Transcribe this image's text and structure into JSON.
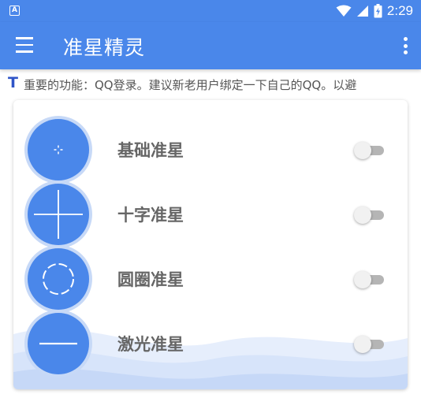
{
  "status_bar": {
    "notification_icon": "A",
    "time": "2:29",
    "icons": [
      "wifi-icon",
      "signal-icon",
      "battery-icon"
    ]
  },
  "app_bar": {
    "title": "准星精灵",
    "menu_icon": "hamburger-menu-icon",
    "overflow_icon": "more-vert-icon"
  },
  "notice": {
    "icon": "T",
    "text": "重要的功能：QQ登录。建议新老用户绑定一下自己的QQ。以避"
  },
  "crosshairs": [
    {
      "label": "基础准星",
      "icon": "basic-crosshair-icon",
      "enabled": false
    },
    {
      "label": "十字准星",
      "icon": "cross-crosshair-icon",
      "enabled": false
    },
    {
      "label": "圆圈准星",
      "icon": "circle-crosshair-icon",
      "enabled": false
    },
    {
      "label": "激光准星",
      "icon": "laser-crosshair-icon",
      "enabled": false
    }
  ],
  "colors": {
    "primary": "#4a87ea",
    "icon_ring": "#c7d9f7",
    "notice_icon": "#2f55c7"
  }
}
